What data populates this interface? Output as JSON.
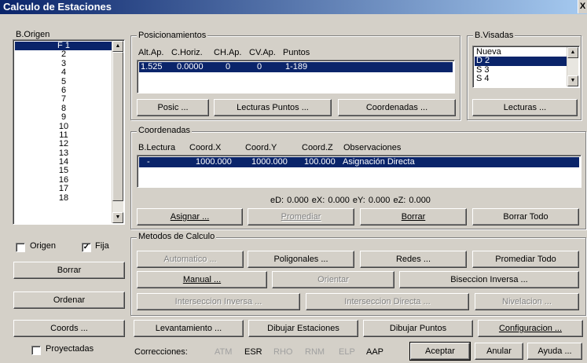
{
  "window": {
    "title": "Calculo de Estaciones",
    "close": "X"
  },
  "origen": {
    "label": "B.Origen",
    "items": [
      "F 1",
      "2",
      "3",
      "4",
      "5",
      "6",
      "7",
      "8",
      "9",
      "10",
      "11",
      "12",
      "13",
      "14",
      "15",
      "16",
      "17",
      "18"
    ],
    "selected": 0
  },
  "posicionamientos": {
    "label": "Posicionamientos",
    "headers": [
      "Alt.Ap.",
      "C.Horiz.",
      "CH.Ap.",
      "CV.Ap.",
      "Puntos"
    ],
    "row": [
      "1.525",
      "0.0000",
      "0",
      "0",
      "1-189"
    ],
    "buttons": [
      "Posic ...",
      "Lecturas Puntos ...",
      "Coordenadas ..."
    ]
  },
  "visadas": {
    "label": "B.Visadas",
    "items": [
      "Nueva",
      "D 2",
      "S 3",
      "S 4"
    ],
    "selected": 1,
    "button": "Lecturas ..."
  },
  "coordenadas": {
    "label": "Coordenadas",
    "headers": [
      "B.Lectura",
      "Coord.X",
      "Coord.Y",
      "Coord.Z",
      "Observaciones"
    ],
    "row": [
      "-",
      "1000.000",
      "1000.000",
      "100.000",
      "Asignación Directa"
    ],
    "errors": "eD: 0.000  eX: 0.000  eY: 0.000  eZ: 0.000",
    "buttons": [
      "Asignar ...",
      "Promediar",
      "Borrar",
      "Borrar Todo"
    ]
  },
  "left": {
    "origen_cb": "Origen",
    "fija_cb": "Fija",
    "borrar": "Borrar",
    "ordenar": "Ordenar",
    "coords": "Coords ...",
    "proyectadas": "Proyectadas"
  },
  "metodos": {
    "label": "Metodos de Calculo",
    "automatico": "Automatico ...",
    "poligonales": "Poligonales ...",
    "redes": "Redes ...",
    "promediar_todo": "Promediar Todo",
    "manual": "Manual ...",
    "orientar": "Orientar",
    "biseccion": "Biseccion Inversa ...",
    "int_inversa": "Interseccion Inversa ...",
    "int_directa": "Interseccion Directa ...",
    "nivelacion": "Nivelacion ..."
  },
  "bottom": {
    "levantamiento": "Levantamiento ...",
    "dibujar_est": "Dibujar Estaciones",
    "dibujar_pts": "Dibujar Puntos",
    "configuracion": "Configuracion ...",
    "correcciones": "Correcciones:",
    "corr": [
      "ATM",
      "ESR",
      "RHO",
      "RNM",
      "ELP",
      "AAP"
    ],
    "aceptar": "Aceptar",
    "anular": "Anular",
    "ayuda": "Ayuda ..."
  }
}
